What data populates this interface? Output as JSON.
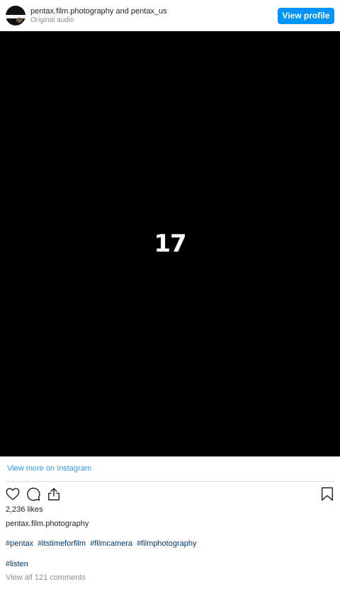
{
  "header": {
    "username": "pentax.film.photography",
    "connector": "and",
    "collaborator": "pentax_us",
    "audio": "Original audio",
    "view_profile_label": "View profile"
  },
  "video": {
    "overlay_text": "17"
  },
  "view_more_label": "View more on Instagram",
  "actions": {
    "like_icon": "heart-icon",
    "comment_icon": "comment-icon",
    "share_icon": "share-icon",
    "save_icon": "bookmark-icon"
  },
  "likes_text": "2,236 likes",
  "caption": {
    "poster": "pentax.film.photography",
    "hashtags": [
      "#pentax",
      "#itstimeforfilm",
      "#filmcamera",
      "#filmphotography"
    ],
    "extra_tag": "#listen"
  },
  "comments_text": "View all 121 comments",
  "colors": {
    "primary_button": "#0095f6",
    "link": "#3897f0",
    "hashtag": "#00376b",
    "muted": "#8e8e8e"
  }
}
